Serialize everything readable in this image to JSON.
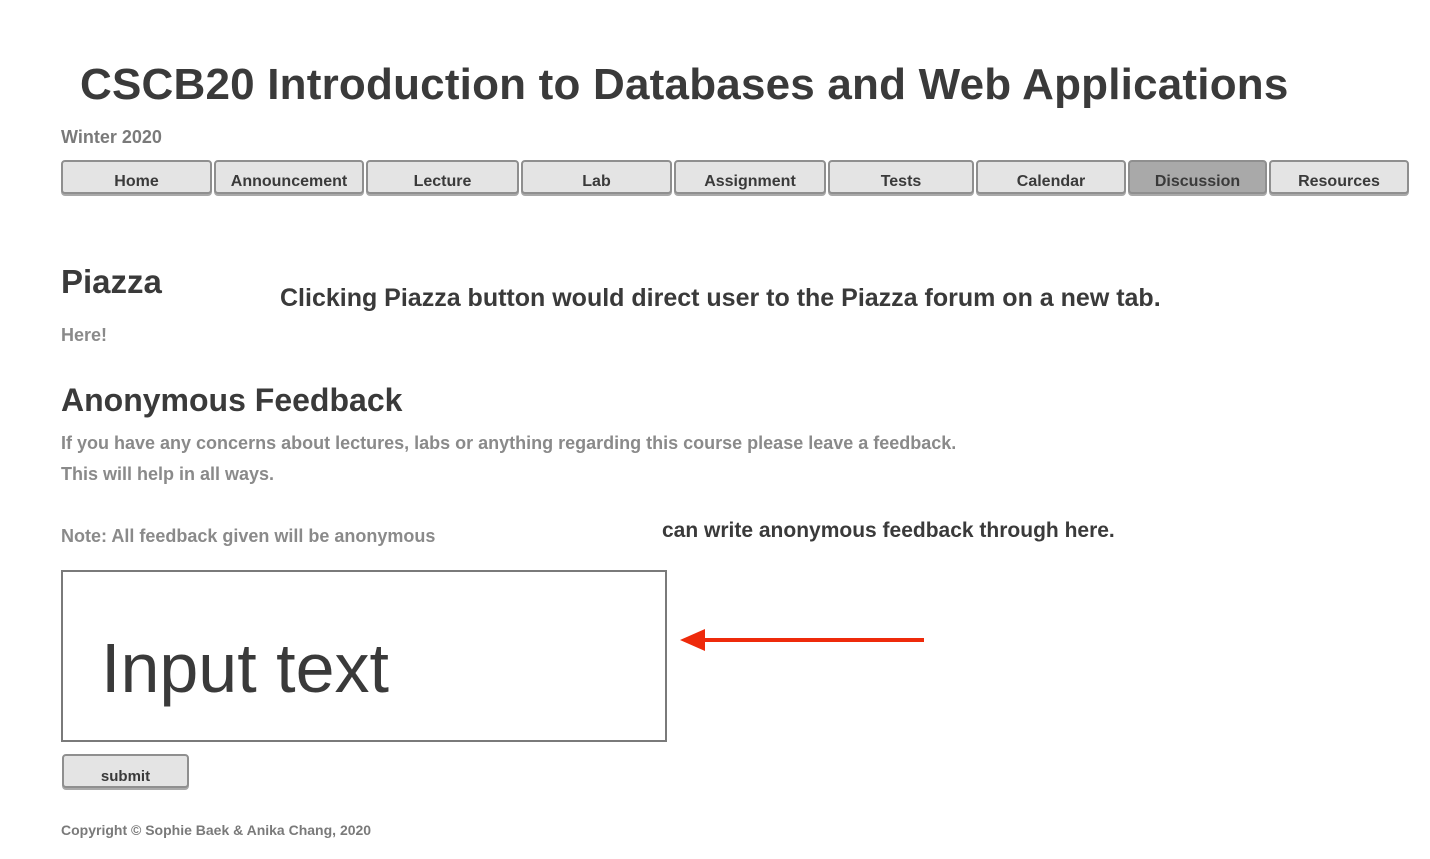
{
  "header": {
    "title": "CSCB20 Introduction to Databases and Web Applications",
    "term": "Winter 2020"
  },
  "nav": {
    "items": [
      {
        "label": "Home",
        "active": false
      },
      {
        "label": "Announcement",
        "active": false
      },
      {
        "label": "Lecture",
        "active": false
      },
      {
        "label": "Lab",
        "active": false
      },
      {
        "label": "Assignment",
        "active": false
      },
      {
        "label": "Tests",
        "active": false
      },
      {
        "label": "Calendar",
        "active": false
      },
      {
        "label": "Discussion",
        "active": true
      },
      {
        "label": "Resources",
        "active": false
      }
    ]
  },
  "piazza": {
    "heading": "Piazza",
    "link_text": "Here!",
    "annotation": "Clicking Piazza button would direct user to the Piazza forum on a new tab."
  },
  "feedback": {
    "heading": "Anonymous Feedback",
    "description_line1": "If you have any concerns about lectures, labs or anything regarding this course please leave a feedback.",
    "description_line2": "This will help in all ways.",
    "note": "Note: All feedback given will be anonymous",
    "annotation": "can write anonymous feedback through here.",
    "input_placeholder": "Input text",
    "submit_label": "submit"
  },
  "footer": {
    "copyright": "Copyright © Sophie Baek & Anika Chang, 2020"
  },
  "colors": {
    "arrow": "#ee2a0b",
    "active_tab": "#a9a9a9",
    "tab": "#e4e4e4",
    "heading_text": "#3a3a3a",
    "muted_text": "#8a8a8a"
  },
  "icons": {
    "annotation_arrow": "left-arrow-icon"
  }
}
